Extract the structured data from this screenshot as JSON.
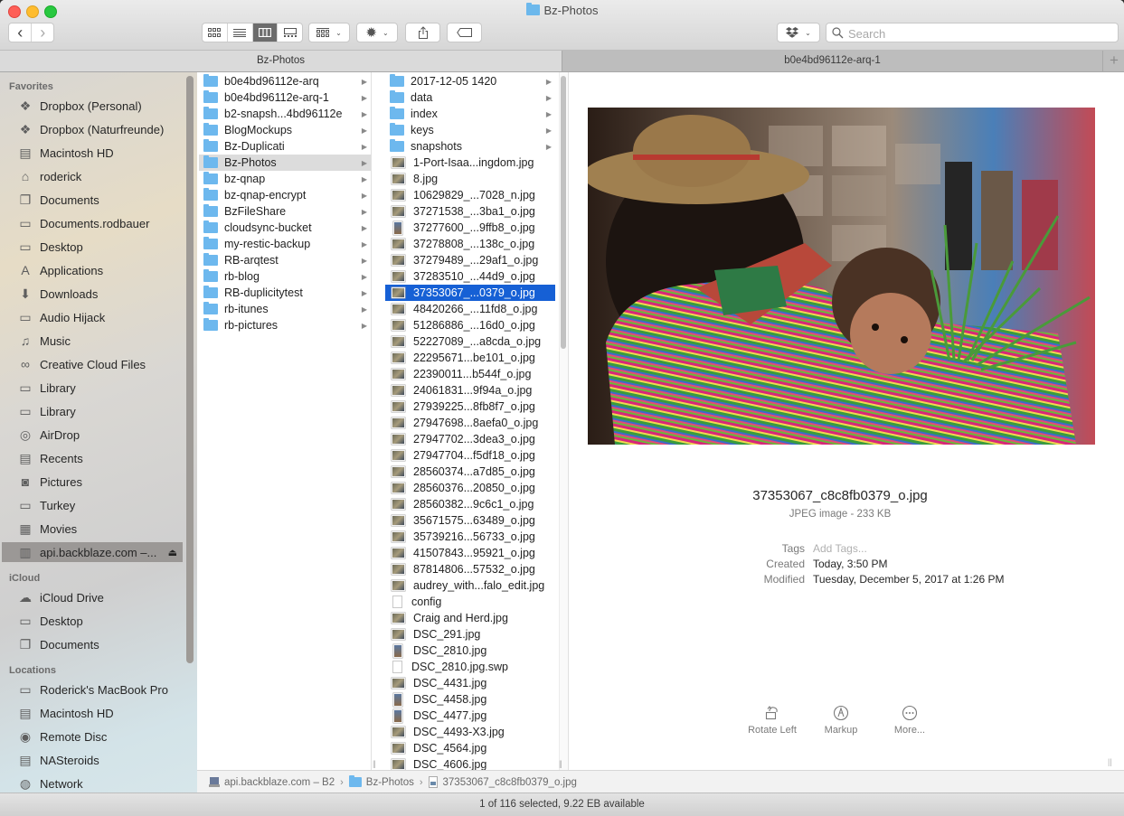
{
  "window": {
    "title": "Bz-Photos"
  },
  "toolbar": {
    "back_label": "‹",
    "forward_label": "›",
    "view_modes": [
      "icon",
      "list",
      "column",
      "gallery"
    ],
    "active_view": "column",
    "search_placeholder": "Search",
    "search_value": ""
  },
  "tabs": [
    {
      "label": "Bz-Photos",
      "active": true
    },
    {
      "label": "b0e4bd96112e-arq-1",
      "active": false
    }
  ],
  "sidebar": {
    "sections": [
      {
        "title": "Favorites",
        "items": [
          {
            "label": "Dropbox (Personal)",
            "icon": "dropbox-icon"
          },
          {
            "label": "Dropbox (Naturfreunde)",
            "icon": "dropbox-icon"
          },
          {
            "label": "Macintosh HD",
            "icon": "hard-drive-icon"
          },
          {
            "label": "roderick",
            "icon": "home-icon"
          },
          {
            "label": "Documents",
            "icon": "documents-icon"
          },
          {
            "label": "Documents.rodbauer",
            "icon": "folder-icon"
          },
          {
            "label": "Desktop",
            "icon": "desktop-icon"
          },
          {
            "label": "Applications",
            "icon": "applications-icon"
          },
          {
            "label": "Downloads",
            "icon": "downloads-icon"
          },
          {
            "label": "Audio Hijack",
            "icon": "folder-icon"
          },
          {
            "label": "Music",
            "icon": "music-icon"
          },
          {
            "label": "Creative Cloud Files",
            "icon": "creative-cloud-icon"
          },
          {
            "label": "Library",
            "icon": "folder-icon"
          },
          {
            "label": "Library",
            "icon": "folder-icon"
          },
          {
            "label": "AirDrop",
            "icon": "airdrop-icon"
          },
          {
            "label": "Recents",
            "icon": "recents-icon"
          },
          {
            "label": "Pictures",
            "icon": "camera-icon"
          },
          {
            "label": "Turkey",
            "icon": "folder-icon"
          },
          {
            "label": "Movies",
            "icon": "film-icon"
          },
          {
            "label": "api.backblaze.com –...",
            "icon": "network-drive-icon",
            "selected": true,
            "eject": "⏏"
          }
        ]
      },
      {
        "title": "iCloud",
        "items": [
          {
            "label": "iCloud Drive",
            "icon": "cloud-icon"
          },
          {
            "label": "Desktop",
            "icon": "desktop-icon"
          },
          {
            "label": "Documents",
            "icon": "documents-icon"
          }
        ]
      },
      {
        "title": "Locations",
        "items": [
          {
            "label": "Roderick's MacBook Pro",
            "icon": "laptop-icon"
          },
          {
            "label": "Macintosh HD",
            "icon": "hard-drive-icon"
          },
          {
            "label": "Remote Disc",
            "icon": "disc-icon"
          },
          {
            "label": "NASteroids",
            "icon": "nas-icon"
          },
          {
            "label": "Network",
            "icon": "network-globe-icon"
          }
        ]
      }
    ]
  },
  "columns": [
    {
      "items": [
        {
          "name": "b0e4bd96112e-arq",
          "type": "folder"
        },
        {
          "name": "b0e4bd96112e-arq-1",
          "type": "folder"
        },
        {
          "name": "b2-snapsh...4bd96112e",
          "type": "folder"
        },
        {
          "name": "BlogMockups",
          "type": "folder"
        },
        {
          "name": "Bz-Duplicati",
          "type": "folder"
        },
        {
          "name": "Bz-Photos",
          "type": "folder",
          "selected": "inactive"
        },
        {
          "name": "bz-qnap",
          "type": "folder"
        },
        {
          "name": "bz-qnap-encrypt",
          "type": "folder"
        },
        {
          "name": "BzFileShare",
          "type": "folder"
        },
        {
          "name": "cloudsync-bucket",
          "type": "folder"
        },
        {
          "name": "my-restic-backup",
          "type": "folder"
        },
        {
          "name": "RB-arqtest",
          "type": "folder"
        },
        {
          "name": "rb-blog",
          "type": "folder"
        },
        {
          "name": "RB-duplicitytest",
          "type": "folder"
        },
        {
          "name": "rb-itunes",
          "type": "folder"
        },
        {
          "name": "rb-pictures",
          "type": "folder"
        }
      ]
    },
    {
      "items": [
        {
          "name": "2017-12-05 1420",
          "type": "folder"
        },
        {
          "name": "data",
          "type": "folder"
        },
        {
          "name": "index",
          "type": "folder"
        },
        {
          "name": "keys",
          "type": "folder"
        },
        {
          "name": "snapshots",
          "type": "folder"
        },
        {
          "name": "1-Port-Isaa...ingdom.jpg",
          "type": "image"
        },
        {
          "name": "8.jpg",
          "type": "image"
        },
        {
          "name": "10629829_...7028_n.jpg",
          "type": "image"
        },
        {
          "name": "37271538_...3ba1_o.jpg",
          "type": "image"
        },
        {
          "name": "37277600_...9ffb8_o.jpg",
          "type": "image-portrait"
        },
        {
          "name": "37278808_...138c_o.jpg",
          "type": "image"
        },
        {
          "name": "37279489_...29af1_o.jpg",
          "type": "image"
        },
        {
          "name": "37283510_...44d9_o.jpg",
          "type": "image"
        },
        {
          "name": "37353067_...0379_o.jpg",
          "type": "image",
          "selected": "active"
        },
        {
          "name": "48420266_...11fd8_o.jpg",
          "type": "image"
        },
        {
          "name": "51286886_...16d0_o.jpg",
          "type": "image"
        },
        {
          "name": "52227089_...a8cda_o.jpg",
          "type": "image"
        },
        {
          "name": "22295671...be101_o.jpg",
          "type": "image"
        },
        {
          "name": "22390011...b544f_o.jpg",
          "type": "image"
        },
        {
          "name": "24061831...9f94a_o.jpg",
          "type": "image"
        },
        {
          "name": "27939225...8fb8f7_o.jpg",
          "type": "image"
        },
        {
          "name": "27947698...8aefa0_o.jpg",
          "type": "image"
        },
        {
          "name": "27947702...3dea3_o.jpg",
          "type": "image"
        },
        {
          "name": "27947704...f5df18_o.jpg",
          "type": "image"
        },
        {
          "name": "28560374...a7d85_o.jpg",
          "type": "image"
        },
        {
          "name": "28560376...20850_o.jpg",
          "type": "image"
        },
        {
          "name": "28560382...9c6c1_o.jpg",
          "type": "image"
        },
        {
          "name": "35671575...63489_o.jpg",
          "type": "image"
        },
        {
          "name": "35739216...56733_o.jpg",
          "type": "image"
        },
        {
          "name": "41507843...95921_o.jpg",
          "type": "image"
        },
        {
          "name": "87814806...57532_o.jpg",
          "type": "image"
        },
        {
          "name": "audrey_with...falo_edit.jpg",
          "type": "image"
        },
        {
          "name": "config",
          "type": "document"
        },
        {
          "name": "Craig and Herd.jpg",
          "type": "image"
        },
        {
          "name": "DSC_291.jpg",
          "type": "image"
        },
        {
          "name": "DSC_2810.jpg",
          "type": "image-portrait"
        },
        {
          "name": "DSC_2810.jpg.swp",
          "type": "document"
        },
        {
          "name": "DSC_4431.jpg",
          "type": "image"
        },
        {
          "name": "DSC_4458.jpg",
          "type": "image-portrait"
        },
        {
          "name": "DSC_4477.jpg",
          "type": "image-portrait"
        },
        {
          "name": "DSC_4493-X3.jpg",
          "type": "image"
        },
        {
          "name": "DSC_4564.jpg",
          "type": "image"
        },
        {
          "name": "DSC_4606.jpg",
          "type": "image"
        }
      ]
    }
  ],
  "preview": {
    "filename": "37353067_c8c8fb0379_o.jpg",
    "kind": "JPEG image - 233 KB",
    "meta": [
      {
        "label": "Tags",
        "value": "Add Tags...",
        "placeholder": true
      },
      {
        "label": "Created",
        "value": "Today, 3:50 PM"
      },
      {
        "label": "Modified",
        "value": "Tuesday, December 5, 2017 at 1:26 PM"
      }
    ],
    "actions": [
      {
        "label": "Rotate Left",
        "icon": "rotate-left-icon"
      },
      {
        "label": "Markup",
        "icon": "markup-icon"
      },
      {
        "label": "More...",
        "icon": "more-icon"
      }
    ]
  },
  "pathbar": {
    "segments": [
      {
        "label": "api.backblaze.com – B2",
        "icon": "network-drive-icon"
      },
      {
        "label": "Bz-Photos",
        "icon": "folder-icon"
      },
      {
        "label": "37353067_c8c8fb0379_o.jpg",
        "icon": "image-file-icon"
      }
    ],
    "separator": "›"
  },
  "status": {
    "text": "1 of 116 selected, 9.22 EB available"
  }
}
